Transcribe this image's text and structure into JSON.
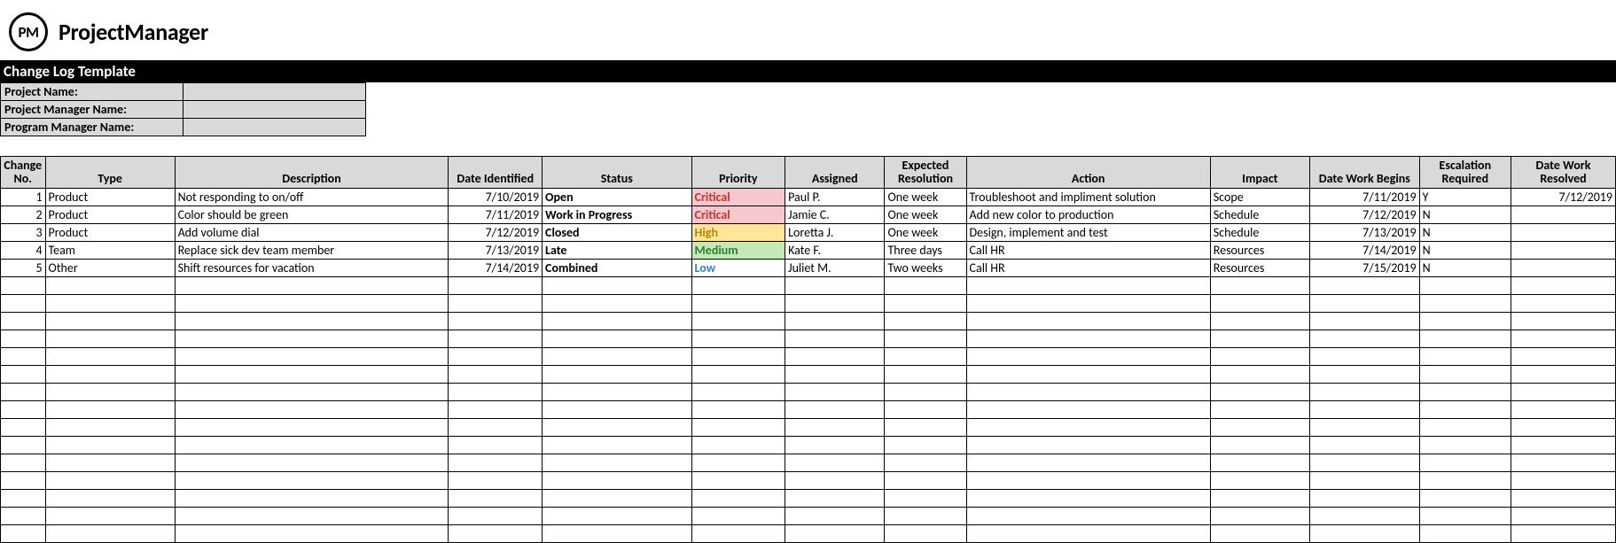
{
  "brand": {
    "badge": "PM",
    "name": "ProjectManager"
  },
  "title": "Change Log Template",
  "meta": {
    "labels": {
      "project": "Project Name:",
      "pm": "Project Manager Name:",
      "prog": "Program Manager Name:"
    },
    "values": {
      "project": "",
      "pm": "",
      "prog": ""
    }
  },
  "headers": {
    "no": "Change No.",
    "type": "Type",
    "desc": "Description",
    "date_id": "Date Identified",
    "status": "Status",
    "priority": "Priority",
    "assigned": "Assigned",
    "exp": "Expected Resolution",
    "action": "Action",
    "impact": "Impact",
    "date_wb": "Date Work Begins",
    "esc": "Escalation Required",
    "date_wr": "Date Work Resolved"
  },
  "rows": [
    {
      "no": "1",
      "type": "Product",
      "desc": "Not responding to on/off",
      "date_id": "7/10/2019",
      "status": "Open",
      "priority": "Critical",
      "priority_class": "pri-critical",
      "assigned": "Paul P.",
      "exp": "One week",
      "action": "Troubleshoot and impliment solution",
      "impact": "Scope",
      "date_wb": "7/11/2019",
      "esc": "Y",
      "date_wr": "7/12/2019"
    },
    {
      "no": "2",
      "type": "Product",
      "desc": "Color should be green",
      "date_id": "7/11/2019",
      "status": "Work in Progress",
      "priority": "Critical",
      "priority_class": "pri-critical",
      "assigned": "Jamie C.",
      "exp": "One week",
      "action": "Add new color to production",
      "impact": "Schedule",
      "date_wb": "7/12/2019",
      "esc": "N",
      "date_wr": ""
    },
    {
      "no": "3",
      "type": "Product",
      "desc": "Add volume dial",
      "date_id": "7/12/2019",
      "status": "Closed",
      "priority": "High",
      "priority_class": "pri-high",
      "assigned": "Loretta J.",
      "exp": "One week",
      "action": "Design, implement and test",
      "impact": "Schedule",
      "date_wb": "7/13/2019",
      "esc": "N",
      "date_wr": ""
    },
    {
      "no": "4",
      "type": "Team",
      "desc": "Replace sick dev team member",
      "date_id": "7/13/2019",
      "status": "Late",
      "priority": "Medium",
      "priority_class": "pri-medium",
      "assigned": "Kate F.",
      "exp": "Three days",
      "action": "Call HR",
      "impact": "Resources",
      "date_wb": "7/14/2019",
      "esc": "N",
      "date_wr": ""
    },
    {
      "no": "5",
      "type": "Other",
      "desc": "Shift resources for vacation",
      "date_id": "7/14/2019",
      "status": "Combined",
      "priority": "Low",
      "priority_class": "pri-low",
      "assigned": "Juliet M.",
      "exp": "Two weeks",
      "action": "Call HR",
      "impact": "Resources",
      "date_wb": "7/15/2019",
      "esc": "N",
      "date_wr": ""
    }
  ],
  "empty_rows": 15
}
